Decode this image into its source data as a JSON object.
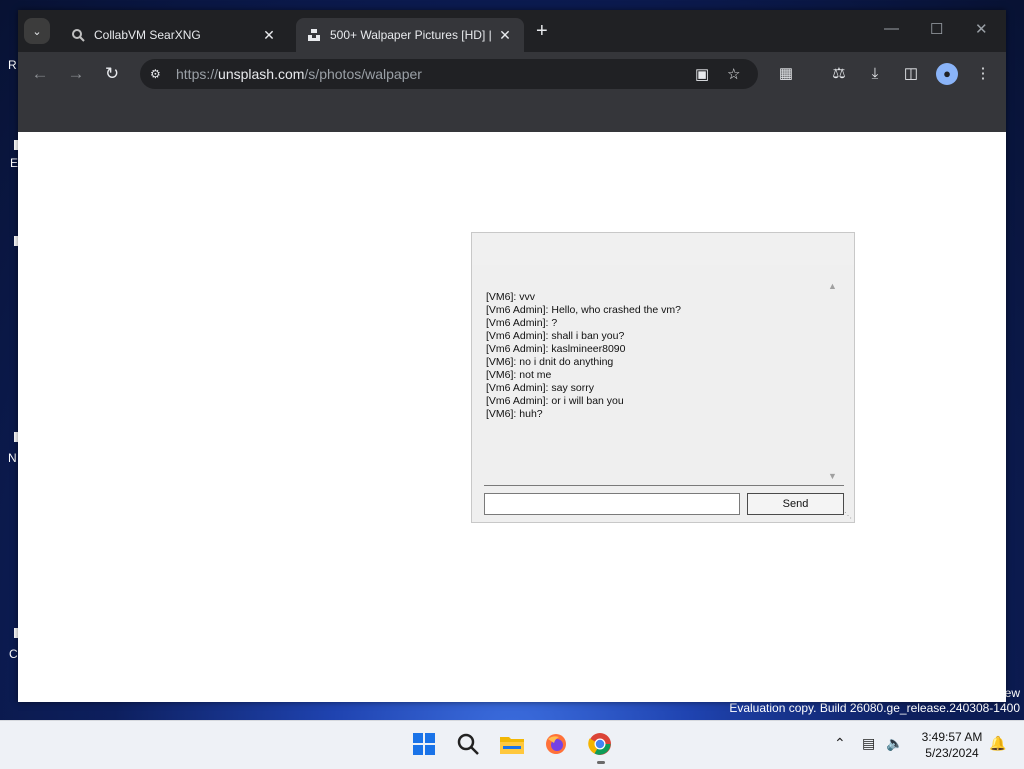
{
  "browser": {
    "tabs": [
      {
        "title": "CollabVM SearXNG",
        "active": false
      },
      {
        "title": "500+ Walpaper Pictures [HD] |",
        "active": true
      }
    ],
    "url_scheme": "https://",
    "url_host": "unsplash.com",
    "url_path": "/s/photos/walpaper"
  },
  "chat": {
    "messages": [
      "[VM6]: vvv",
      "[Vm6 Admin]: Hello, who crashed the vm?",
      "[Vm6 Admin]: ?",
      "[Vm6 Admin]: shall i ban you?",
      "[Vm6 Admin]: kaslmineer8090",
      "[VM6]: no i dnit do anything",
      "[VM6]: not me",
      "[Vm6 Admin]: say sorry",
      "[Vm6 Admin]: or i will ban you",
      "[VM6]: huh?"
    ],
    "input_value": "",
    "send_label": "Send"
  },
  "desktop": {
    "watermark_line1": "ew",
    "watermark_line2": "Evaluation copy. Build 26080.ge_release.240308-1400",
    "edge_labels": [
      "R",
      "E",
      "N",
      "C"
    ]
  },
  "taskbar": {
    "apps": [
      "windows-start-icon",
      "search-icon",
      "file-explorer-icon",
      "firefox-icon",
      "chrome-icon"
    ],
    "time": "3:49:57 AM",
    "date": "5/23/2024"
  },
  "colors": {
    "tabstrip": "#202124",
    "toolbar": "#35363a",
    "taskbar": "#eef1f6"
  }
}
